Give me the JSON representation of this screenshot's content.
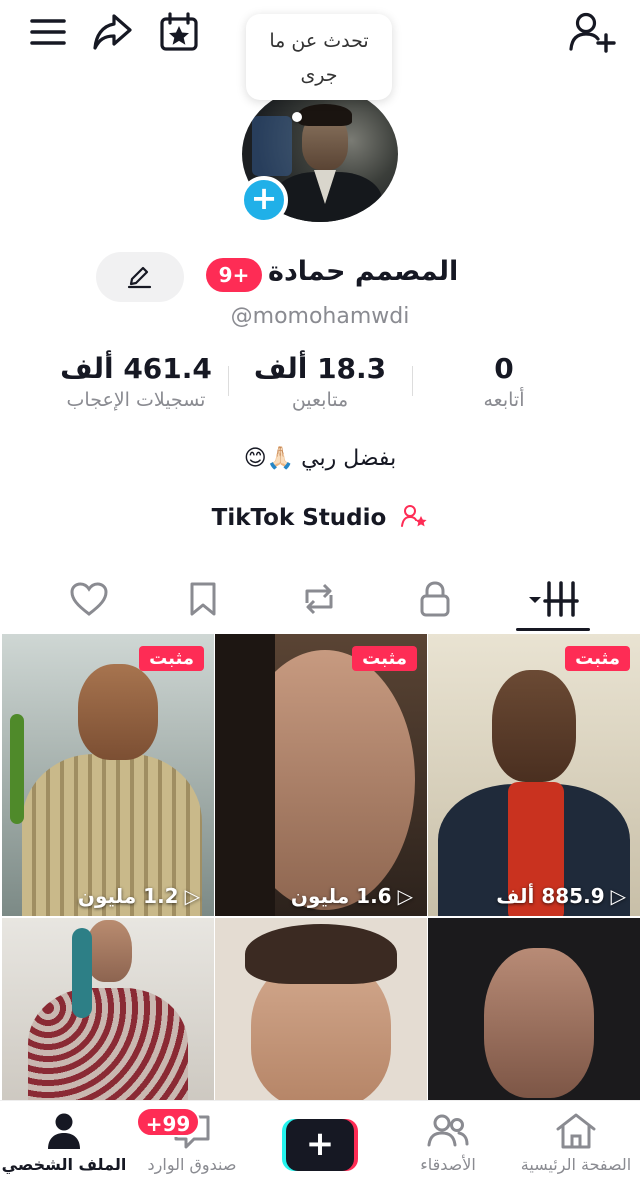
{
  "profile": {
    "speech_bubble": [
      "تحدث عن ما",
      "جرى"
    ],
    "name": "المصمم حمادة",
    "notification_badge": "9+",
    "username": "@momohamwdi",
    "bio": "بفضل ربي 🙏🏻😊",
    "studio_label": "TikTok Studio"
  },
  "stats": {
    "following": {
      "value": "0",
      "label": "أتابعه"
    },
    "followers": {
      "value": "18.3 ألف",
      "label": "متابعين"
    },
    "likes": {
      "value": "461.4 ألف",
      "label": "تسجيلات الإعجاب"
    }
  },
  "videos": [
    {
      "pinned_label": "مثبت",
      "views": "885.9 ألف"
    },
    {
      "pinned_label": "مثبت",
      "views": "1.6 مليون"
    },
    {
      "pinned_label": "مثبت",
      "views": "1.2 مليون"
    }
  ],
  "bottom_nav": {
    "home": "الصفحة الرئيسية",
    "friends": "الأصدقاء",
    "create": "+",
    "inbox": "صندوق الوارد",
    "inbox_badge": "+99",
    "profile": "الملف الشخصي"
  },
  "colors": {
    "accent": "#fe2c55",
    "cyan": "#25f4ee",
    "text": "#161823",
    "muted": "#8a8b91"
  },
  "icons": {
    "menu": "hamburger-menu-icon",
    "share": "share-arrow-icon",
    "calendar": "calendar-star-icon",
    "add_friend": "add-user-icon",
    "edit": "pencil-icon"
  }
}
